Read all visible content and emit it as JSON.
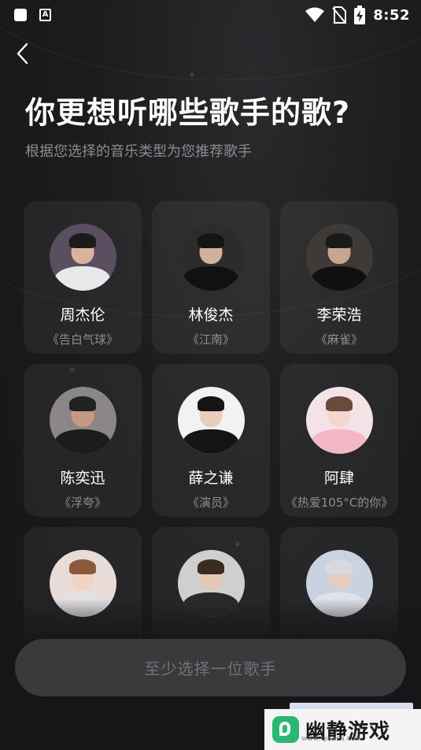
{
  "status_bar": {
    "time": "8:52",
    "left_icons": [
      "square-icon",
      "a-box-icon"
    ],
    "right_icons": [
      "wifi-icon",
      "no-sim-icon",
      "battery-charging-icon"
    ]
  },
  "header": {
    "back_icon": "chevron-left-icon",
    "title": "你更想听哪些歌手的歌?",
    "subtitle": "根据您选择的音乐类型为您推荐歌手"
  },
  "singers": [
    {
      "name": "周杰伦",
      "song": "《告白气球》",
      "bg": "#5a4e60",
      "skin": "#d9b49b",
      "hair": "#1b1b1b",
      "body": "#e8e8ea"
    },
    {
      "name": "林俊杰",
      "song": "《江南》",
      "bg": "#2c2c2c",
      "skin": "#d3b09a",
      "hair": "#151515",
      "body": "#111111"
    },
    {
      "name": "李荣浩",
      "song": "《麻雀》",
      "bg": "#3d3a37",
      "skin": "#c7a58e",
      "hair": "#1a1a1a",
      "body": "#101010"
    },
    {
      "name": "陈奕迅",
      "song": "《浮夸》",
      "bg": "#8a8786",
      "skin": "#c49a80",
      "hair": "#222222",
      "body": "#1c1c1c"
    },
    {
      "name": "薛之谦",
      "song": "《演员》",
      "bg": "#f2f2f2",
      "skin": "#e8cdbd",
      "hair": "#141414",
      "body": "#141414"
    },
    {
      "name": "阿肆",
      "song": "《热爱105°C的你》",
      "bg": "#f4e3e6",
      "skin": "#f3d6cc",
      "hair": "#6b4a3c",
      "body": "#f3b8c6"
    },
    {
      "name": "",
      "song": "",
      "bg": "#e9dcd8",
      "skin": "#f0d5c6",
      "hair": "#8a5a3d",
      "body": "#e3e0e4"
    },
    {
      "name": "",
      "song": "",
      "bg": "#cfcfcf",
      "skin": "#e6c6b4",
      "hair": "#3a2a22",
      "body": "#2a2a2a"
    },
    {
      "name": "",
      "song": "",
      "bg": "#c9d3e0",
      "skin": "#e2cdbf",
      "hair": "#d7d9df",
      "body": "#dfe2ea"
    }
  ],
  "footer": {
    "confirm_label": "至少选择一位歌手"
  },
  "watermark": {
    "text": "幽静游戏",
    "sub": "WWW.YJISREN.COM"
  }
}
